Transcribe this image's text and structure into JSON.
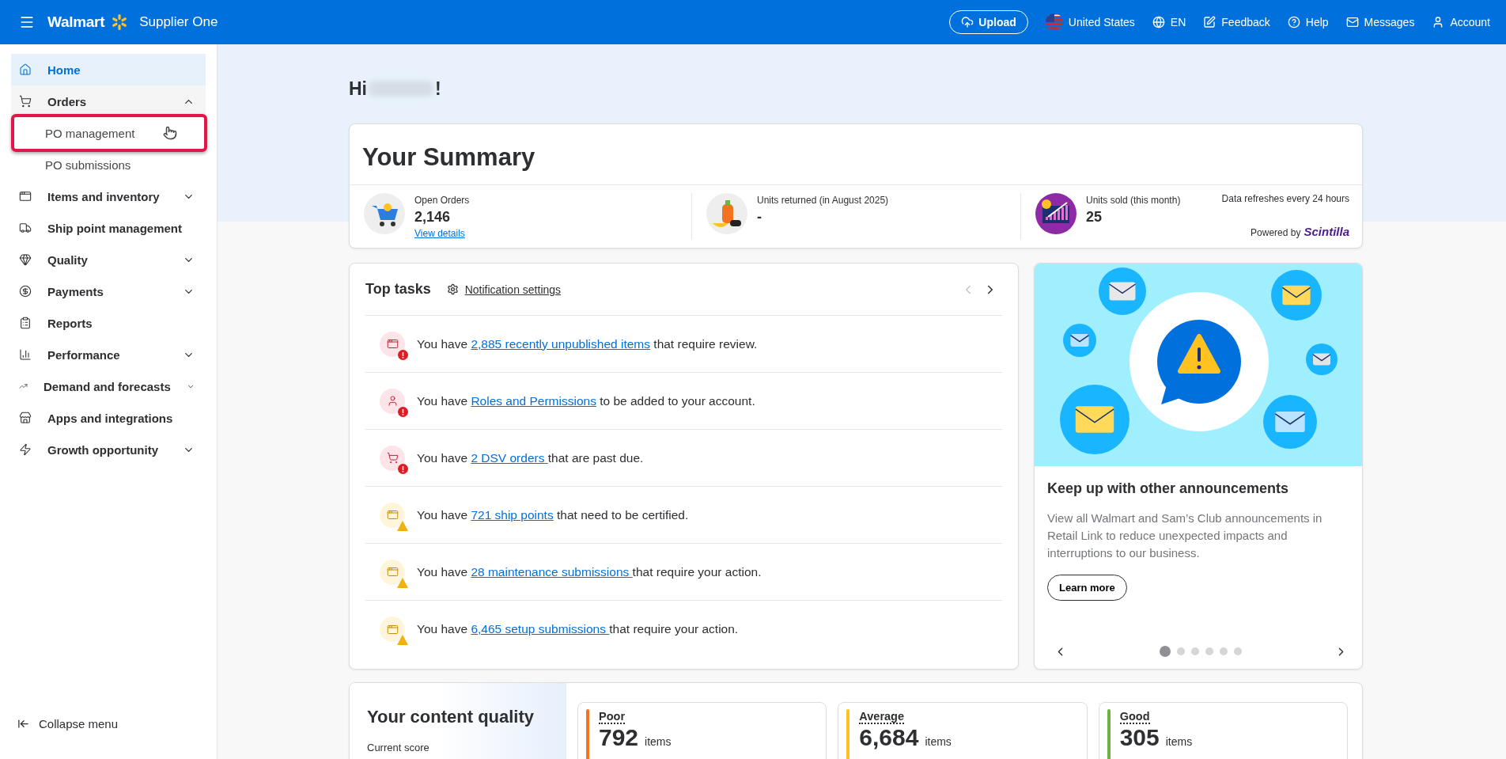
{
  "header": {
    "brand": "Walmart",
    "product": "Supplier One",
    "upload": "Upload",
    "country": "United States",
    "language": "EN",
    "links": [
      "Feedback",
      "Help",
      "Messages",
      "Account"
    ]
  },
  "sidebar": {
    "items": [
      {
        "kind": "link",
        "label": "Home",
        "selected": true
      },
      {
        "kind": "menu",
        "label": "Orders",
        "selected": false,
        "expanded": true,
        "children": [
          {
            "label": "PO management",
            "highlighted": true,
            "hovered": true
          },
          {
            "label": "PO submissions",
            "highlighted": false,
            "hovered": false
          }
        ]
      },
      {
        "kind": "menu",
        "label": "Items and inventory",
        "selected": false,
        "expanded": false
      },
      {
        "kind": "link",
        "label": "Ship point management",
        "selected": false
      },
      {
        "kind": "menu",
        "label": "Quality",
        "selected": false,
        "expanded": false
      },
      {
        "kind": "menu",
        "label": "Payments",
        "selected": false,
        "expanded": false
      },
      {
        "kind": "link",
        "label": "Reports",
        "selected": false
      },
      {
        "kind": "menu",
        "label": "Performance",
        "selected": false,
        "expanded": false
      },
      {
        "kind": "menu",
        "label": "Demand and forecasts",
        "selected": false,
        "expanded": false
      },
      {
        "kind": "link",
        "label": "Apps and integrations",
        "selected": false
      },
      {
        "kind": "menu",
        "label": "Growth opportunity",
        "selected": false,
        "expanded": false
      }
    ],
    "collapse": "Collapse menu"
  },
  "greeting": {
    "prefix": "Hi",
    "suffix": "!"
  },
  "summary": {
    "title": "Your Summary",
    "stats": [
      {
        "label": "Open Orders",
        "value": "2,146",
        "link": "View details"
      },
      {
        "label": "Units returned (in August 2025)",
        "value": "-"
      },
      {
        "label": "Units sold (this month)",
        "value": "25"
      }
    ],
    "refresh_note": "Data refreshes every 24 hours",
    "powered_by": "Powered by",
    "partner": "Scintilla"
  },
  "top_tasks": {
    "title": "Top tasks",
    "settings_link": "Notification settings",
    "prev_disabled": true,
    "next_disabled": false,
    "tasks": [
      {
        "kind": "error",
        "prefix": "You have ",
        "link": "2,885 recently unpublished items",
        "suffix": " that require review."
      },
      {
        "kind": "error",
        "prefix": "You have ",
        "link": "Roles and Permissions",
        "suffix": " to be added to your account."
      },
      {
        "kind": "error",
        "prefix": "You have ",
        "link": "2 DSV orders ",
        "suffix": "that are past due."
      },
      {
        "kind": "warning",
        "prefix": "You have ",
        "link": "721 ship points",
        "suffix": " that need to be certified."
      },
      {
        "kind": "warning",
        "prefix": "You have ",
        "link": "28 maintenance submissions ",
        "suffix": "that require your action."
      },
      {
        "kind": "warning",
        "prefix": "You have ",
        "link": "6,465 setup submissions ",
        "suffix": "that require your action."
      }
    ]
  },
  "announcement": {
    "title": "Keep up with other announcements",
    "body": "View all Walmart and Sam’s Club announcements in Retail Link to reduce unexpected impacts and interruptions to our business.",
    "button": "Learn more",
    "dots": [
      {
        "selected": true
      },
      {
        "selected": false
      },
      {
        "selected": false
      },
      {
        "selected": false
      },
      {
        "selected": false
      },
      {
        "selected": false
      }
    ]
  },
  "content_quality": {
    "title": "Your content quality",
    "subtitle": "Current score",
    "scores": [
      {
        "label": "Poor",
        "value": "792",
        "unit": "items",
        "color": "#f47321"
      },
      {
        "label": "Average",
        "value": "6,684",
        "unit": "items",
        "color": "#ffc220"
      },
      {
        "label": "Good",
        "value": "305",
        "unit": "items",
        "color": "#6db33f"
      }
    ]
  }
}
